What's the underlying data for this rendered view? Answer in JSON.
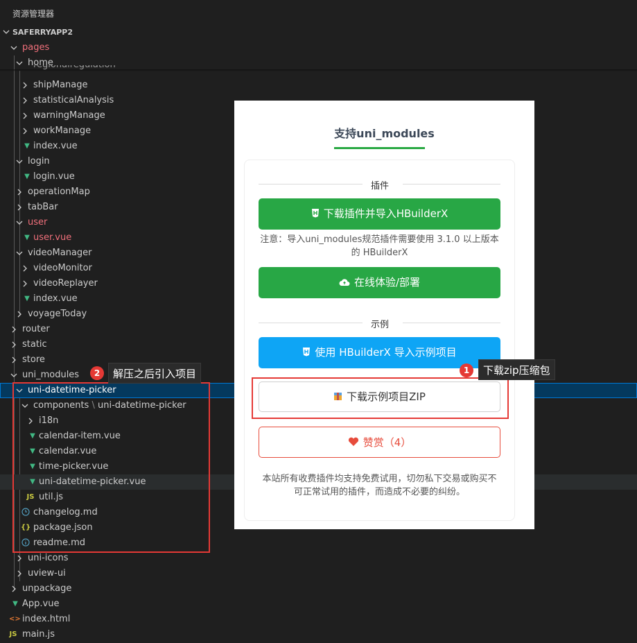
{
  "explorer": {
    "title": "资源管理器",
    "root": "SAFERRYAPP2",
    "items": [
      {
        "label": "pages"
      },
      {
        "label": "home"
      },
      {
        "label": "regionalregulation"
      },
      {
        "label": "shipManage"
      },
      {
        "label": "statisticalAnalysis"
      },
      {
        "label": "warningManage"
      },
      {
        "label": "workManage"
      },
      {
        "label": "index.vue"
      },
      {
        "label": "login"
      },
      {
        "label": "login.vue"
      },
      {
        "label": "operationMap"
      },
      {
        "label": "tabBar"
      },
      {
        "label": "user"
      },
      {
        "label": "user.vue"
      },
      {
        "label": "videoManager"
      },
      {
        "label": "videoMonitor"
      },
      {
        "label": "videoReplayer"
      },
      {
        "label": "index.vue"
      },
      {
        "label": "voyageToday"
      },
      {
        "label": "router"
      },
      {
        "label": "static"
      },
      {
        "label": "store"
      },
      {
        "label": "uni_modules"
      },
      {
        "label": "uni-datetime-picker"
      },
      {
        "label": "components",
        "suffix": "uni-datetime-picker"
      },
      {
        "label": "i18n"
      },
      {
        "label": "calendar-item.vue"
      },
      {
        "label": "calendar.vue"
      },
      {
        "label": "time-picker.vue"
      },
      {
        "label": "uni-datetime-picker.vue"
      },
      {
        "label": "util.js"
      },
      {
        "label": "changelog.md"
      },
      {
        "label": "package.json"
      },
      {
        "label": "readme.md"
      },
      {
        "label": "uni-icons"
      },
      {
        "label": "uview-ui"
      },
      {
        "label": "unpackage"
      },
      {
        "label": "App.vue"
      },
      {
        "label": "index.html"
      },
      {
        "label": "main.js"
      }
    ]
  },
  "annotations": {
    "badge1": "1",
    "tip1": "下载zip压缩包",
    "badge2": "2",
    "tip2": "解压之后引入项目"
  },
  "plugin_panel": {
    "tab": "支持uni_modules",
    "section_plugin": "插件",
    "btn_download_import": "下载插件并导入HBuilderX",
    "note": "注意：导入uni_modules规范插件需要使用 3.1.0 以上版本的 HBuilderX",
    "btn_online": "在线体验/部署",
    "section_example": "示例",
    "btn_example_import": "使用 HBuilderX 导入示例项目",
    "btn_example_zip": "下载示例项目ZIP",
    "btn_zan": "赞赏（4）",
    "footer_note": "本站所有收费插件均支持免费试用，切勿私下交易或购买不可正常试用的插件，而造成不必要的纠纷。",
    "colors": {
      "green": "#28a745",
      "blue": "#0ea5f5",
      "red": "#e74c3c"
    }
  }
}
